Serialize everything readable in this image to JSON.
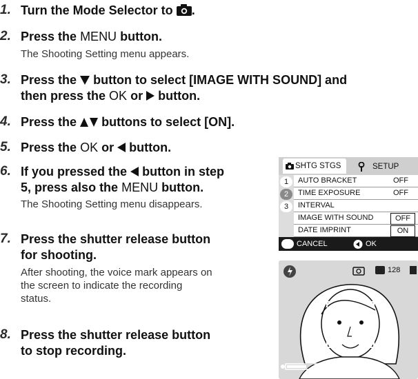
{
  "steps": [
    {
      "num": "1.",
      "pre": "Turn the Mode Selector to",
      "post": "."
    },
    {
      "num": "2.",
      "pre": "Press the",
      "key": "MENU",
      "post": "button.",
      "sub": "The Shooting Setting menu appears."
    },
    {
      "num": "3.",
      "pre": "Press the",
      "post": "button to select [IMAGE WITH SOUND] and",
      "line2_pre": "then press the",
      "key": "OK",
      "line2_mid": "or",
      "line2_post": "button."
    },
    {
      "num": "4.",
      "pre": "Press the",
      "post": "buttons to select [ON]."
    },
    {
      "num": "5.",
      "pre": "Press the",
      "key": "OK",
      "mid": "or",
      "post": "button."
    },
    {
      "num": "6.",
      "pre": "If you pressed the",
      "post": "button in step",
      "line2_pre": "5, press also the",
      "key": "MENU",
      "line2_post": "button.",
      "sub": "The Shooting Setting menu disappears."
    },
    {
      "num": "7.",
      "line1": "Press the shutter release button",
      "line2": "for shooting.",
      "sub1": "After shooting, the voice mark appears on",
      "sub2": "the screen to indicate the recording",
      "sub3": "status."
    },
    {
      "num": "8.",
      "line1": "Press the shutter release button",
      "line2": "to stop recording."
    }
  ],
  "menu_screen": {
    "tab_shooting": "SHTG STGS",
    "tab_setup": "SETUP",
    "pages": [
      "1",
      "2",
      "3"
    ],
    "rows": [
      {
        "label": "AUTO BRACKET",
        "value": "OFF"
      },
      {
        "label": "TIME EXPOSURE",
        "value": "OFF"
      },
      {
        "label": "INTERVAL",
        "value": ""
      },
      {
        "label": "IMAGE WITH SOUND",
        "value": "OFF"
      },
      {
        "label": "DATE IMPRINT",
        "value": "ON"
      }
    ],
    "footer_cancel": "CANCEL",
    "footer_ok": "OK"
  },
  "preview_screen": {
    "remaining": "128"
  }
}
